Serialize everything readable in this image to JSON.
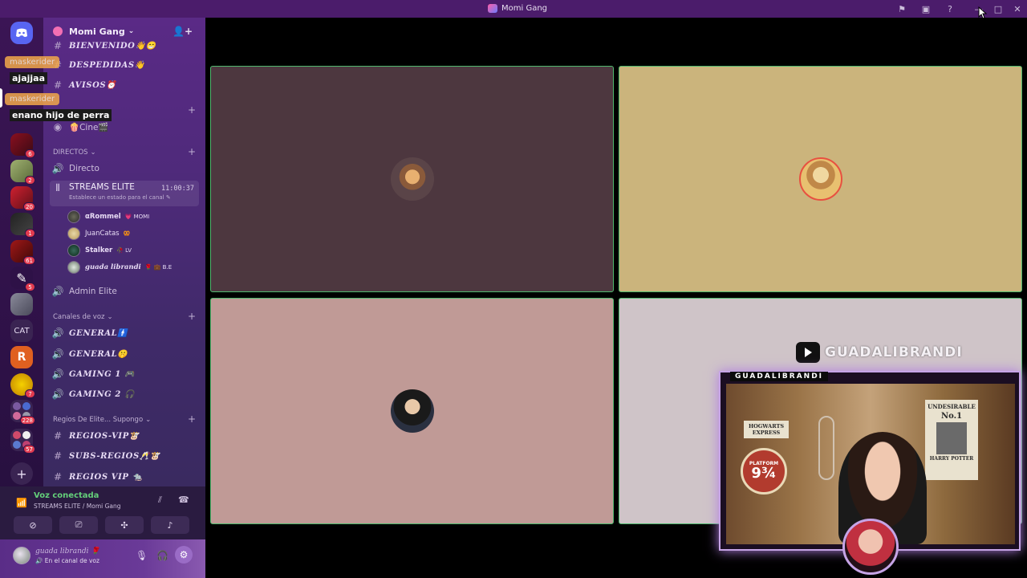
{
  "window": {
    "title": "Momi Gang"
  },
  "guild": {
    "name": "Momi Gang"
  },
  "channels": {
    "top": [
      {
        "name": "BIENVENIDO👋😁"
      },
      {
        "name": "DESPEDIDAS👋"
      },
      {
        "name": "AVISOS⏰"
      }
    ],
    "stage": {
      "name": "🍿Cine🎬"
    },
    "directos_category": "DIRECTOS",
    "directos": [
      {
        "name": "Directo"
      },
      {
        "name": "STREAMS ELITE",
        "time": "11:00:37",
        "status_prompt": "Establece un estado para el canal"
      }
    ],
    "members": [
      {
        "name": "αRommel",
        "tag": "💗 MOMI"
      },
      {
        "name": "JuanCatas",
        "tag": "🥨"
      },
      {
        "name": "Stalker",
        "tag": "🥀 LV"
      },
      {
        "name": "guada librandi",
        "tag": "🌹 💼 B.E"
      }
    ],
    "admin": {
      "name": "Admin Elite"
    },
    "voice_category": "Canales de voz",
    "voice": [
      {
        "name": "GENERAL🚹"
      },
      {
        "name": "GENERAL🤫"
      },
      {
        "name": "GAMING 1 🎮"
      },
      {
        "name": "GAMING 2 🎧"
      }
    ],
    "regios_category": "Regios De Elite... Supongo",
    "regios": [
      {
        "name": "REGIOS-VIP🐮"
      },
      {
        "name": "SUBS-REGIOS🥂🐮"
      },
      {
        "name": "REGIOS VIP 🐀"
      }
    ]
  },
  "servers": {
    "badges": [
      "6",
      "2",
      "20",
      "1",
      "61",
      "5",
      "7",
      "228",
      "57"
    ],
    "cat_label": "CAT"
  },
  "overlay_chat": {
    "label1": "maskerider",
    "msg1": "ajajjaa",
    "label2": "maskerider",
    "msg2": "enano hijo de perra"
  },
  "voice_panel": {
    "title": "Voz conectada",
    "subtitle": "STREAMS ELITE / Momi Gang"
  },
  "user_panel": {
    "name": "guada librandi 🌹",
    "status": "🔊 En el canal de voz"
  },
  "stream_overlay": {
    "youtube_name": "GUADALIBRANDI",
    "cam_tag": "GUADALIBRANDI",
    "poster1_title": "HOGWARTS EXPRESS",
    "poster2_title": "UNDESIRABLE",
    "poster2_sub": "No.1",
    "poster2_name": "HARRY POTTER",
    "platform_label": "PLATFORM",
    "platform_number": "9¾"
  },
  "colors": {
    "titlebar": "#4b1c6b",
    "tile_border": "#4fb86e",
    "tile1_bg": "#4d373f",
    "tile2_bg": "#cbb47c",
    "tile3_bg": "#c09a96",
    "tile4_bg": "#cfc4c8",
    "voice_green": "#64d07a"
  }
}
